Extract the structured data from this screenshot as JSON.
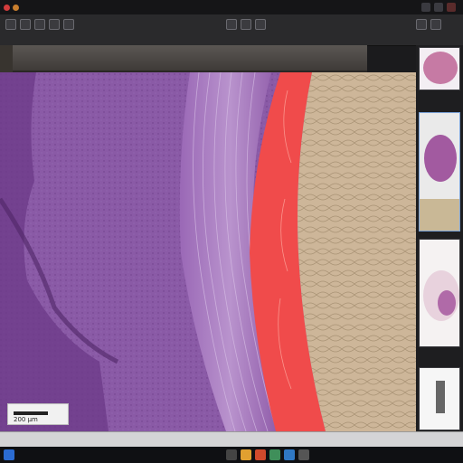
{
  "window": {
    "title": "",
    "icons": [
      "app-icon",
      "minimize-icon",
      "maximize-icon",
      "close-icon"
    ]
  },
  "toolbar": {
    "tools": [
      "open-icon",
      "save-icon",
      "zoom-in-icon",
      "zoom-out-icon",
      "pan-icon",
      "annotate-icon",
      "measure-icon",
      "rotate-icon",
      "settings-icon",
      "help-icon"
    ],
    "zoom_text": ""
  },
  "viewer": {
    "image_description_icon": "histology-slide-view",
    "scale_bar_label": "200 μm"
  },
  "thumbnails": {
    "count": 5,
    "selected_index": 1
  },
  "status": {
    "left": "",
    "center": "",
    "right": ""
  },
  "taskbar": {
    "icons": [
      "start-icon",
      "search-icon",
      "file-explorer-icon",
      "browser-icon",
      "viewer-app-icon",
      "mail-icon",
      "settings-icon"
    ],
    "clock": ""
  },
  "colors": {
    "tissue_purple": "#8a5aa6",
    "tissue_dark_purple": "#6b3a87",
    "fibers": "#b08cc4",
    "red_layer": "#f04b4b",
    "beige_tissue": "#cdb699",
    "panel": "#1e1e20"
  }
}
